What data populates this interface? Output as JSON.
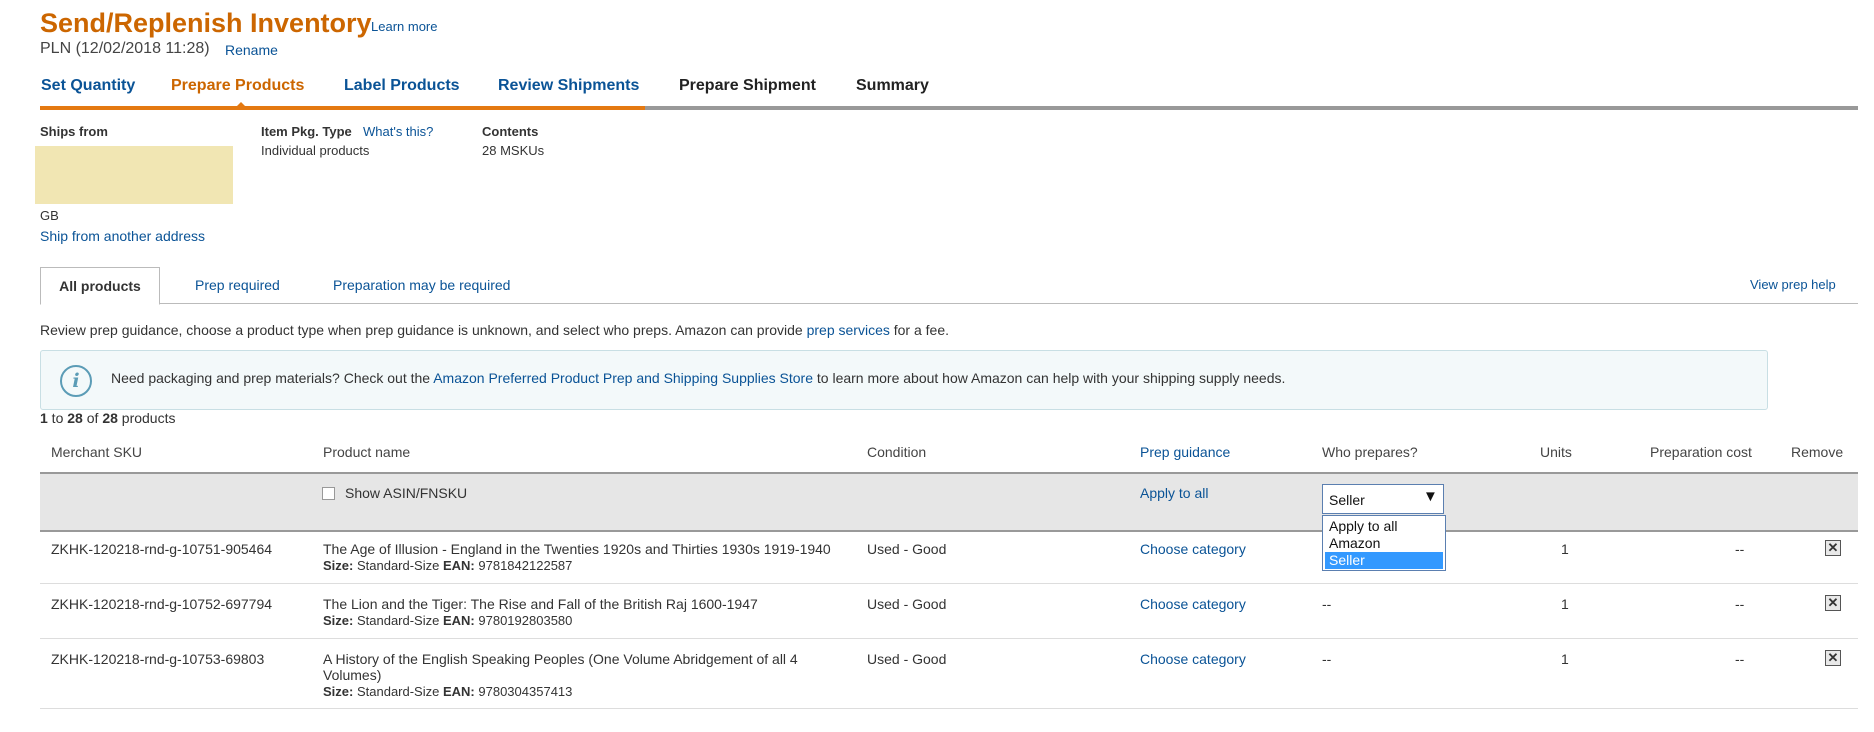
{
  "header": {
    "title": "Send/Replenish Inventory",
    "learn_more": "Learn more",
    "plan_name": "PLN (12/02/2018 11:28)",
    "rename": "Rename"
  },
  "steps": [
    {
      "label": "Set Quantity",
      "state": "done"
    },
    {
      "label": "Prepare Products",
      "state": "active"
    },
    {
      "label": "Label Products",
      "state": "done"
    },
    {
      "label": "Review Shipments",
      "state": "done"
    },
    {
      "label": "Prepare Shipment",
      "state": "todo"
    },
    {
      "label": "Summary",
      "state": "todo"
    }
  ],
  "ships": {
    "ships_from_label": "Ships from",
    "country": "GB",
    "ship_from_another": "Ship from another address",
    "pkg_type_label": "Item Pkg. Type",
    "whats_this": "What's this?",
    "pkg_type_value": "Individual products",
    "contents_label": "Contents",
    "contents_value": "28 MSKUs"
  },
  "tabs": {
    "all": "All products",
    "prep_required": "Prep required",
    "prep_maybe": "Preparation may be required",
    "view_help": "View prep help"
  },
  "guidance": {
    "text_before": "Review prep guidance, choose a product type when prep guidance is unknown, and select who preps. Amazon can provide ",
    "link": "prep services",
    "text_after": " for a fee."
  },
  "info": {
    "text_before": "Need packaging and prep materials? Check out the ",
    "link": "Amazon Preferred Product Prep and Shipping Supplies Store",
    "text_after": " to learn more about how Amazon can help with your shipping supply needs."
  },
  "count": {
    "from": "1",
    "to_word": " to ",
    "to": "28",
    "of_word": " of ",
    "total": "28",
    "suffix": " products"
  },
  "table": {
    "headers": {
      "sku": "Merchant SKU",
      "name": "Product name",
      "condition": "Condition",
      "prep_guidance": "Prep guidance",
      "who": "Who prepares?",
      "units": "Units",
      "cost": "Preparation cost",
      "remove": "Remove"
    },
    "filter": {
      "show_asin": "Show ASIN/FNSKU",
      "apply_all": "Apply to all",
      "who_value": "Seller",
      "who_options": [
        "Apply to all",
        "Amazon",
        "Seller"
      ]
    },
    "rows": [
      {
        "sku": "ZKHK-120218-rnd-g-10751-905464",
        "name": "The Age of Illusion - England in the Twenties 1920s and Thirties 1930s 1919-1940",
        "size_label": "Size:",
        "size": "Standard-Size",
        "ean_label": "EAN:",
        "ean": "9781842122587",
        "condition": "Used - Good",
        "prep": "Choose category",
        "who": "",
        "units": "1",
        "cost": "--"
      },
      {
        "sku": "ZKHK-120218-rnd-g-10752-697794",
        "name": "The Lion and the Tiger: The Rise and Fall of the British Raj 1600-1947",
        "size_label": "Size:",
        "size": "Standard-Size",
        "ean_label": "EAN:",
        "ean": "9780192803580",
        "condition": "Used - Good",
        "prep": "Choose category",
        "who": "--",
        "units": "1",
        "cost": "--"
      },
      {
        "sku": "ZKHK-120218-rnd-g-10753-69803",
        "name_line1": "A History of the English Speaking Peoples (One Volume Abridgement of all 4",
        "name_line2": "Volumes)",
        "size_label": "Size:",
        "size": "Standard-Size",
        "ean_label": "EAN:",
        "ean": "9780304357413",
        "condition": "Used - Good",
        "prep": "Choose category",
        "who": "--",
        "units": "1",
        "cost": "--"
      }
    ]
  },
  "colors": {
    "brand_orange": "#cc6600",
    "link_blue": "#0a5396",
    "progress": "#e47911"
  },
  "icons": {
    "info": "info-circle-icon",
    "remove": "close-x-icon",
    "dropdown": "dropdown-arrow-icon"
  }
}
